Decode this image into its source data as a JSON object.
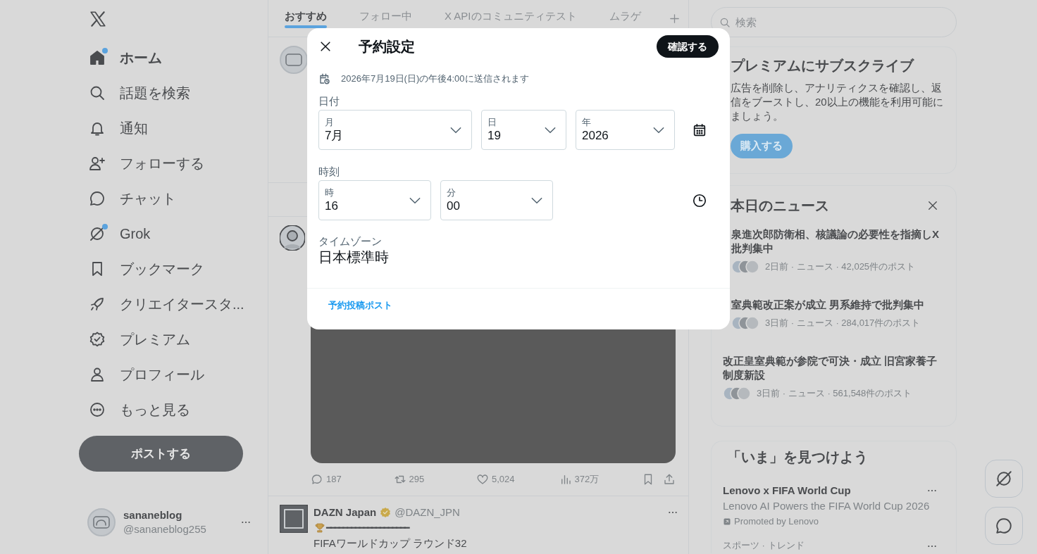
{
  "sidebar": {
    "items": [
      {
        "label": "ホーム",
        "selected": true,
        "notification_dot": true
      },
      {
        "label": "話題を検索",
        "selected": false,
        "notification_dot": false
      },
      {
        "label": "通知",
        "selected": false,
        "notification_dot": false
      },
      {
        "label": "フォローする",
        "selected": false,
        "notification_dot": false
      },
      {
        "label": "チャット",
        "selected": false,
        "notification_dot": false
      },
      {
        "label": "Grok",
        "selected": false,
        "notification_dot": true
      },
      {
        "label": "ブックマーク",
        "selected": false,
        "notification_dot": false
      },
      {
        "label": "クリエイタースタ...",
        "selected": false,
        "notification_dot": false
      },
      {
        "label": "プレミアム",
        "selected": false,
        "notification_dot": false
      },
      {
        "label": "プロフィール",
        "selected": false,
        "notification_dot": false
      },
      {
        "label": "もっと見る",
        "selected": false,
        "notification_dot": false
      }
    ],
    "post_button": "ポストする",
    "account": {
      "name": "sananeblog",
      "handle": "@sananeblog255"
    }
  },
  "timeline": {
    "tabs": [
      {
        "label": "おすすめ",
        "selected": true
      },
      {
        "label": "フォロー中",
        "selected": false
      },
      {
        "label": "X APIのコミュニティテスト",
        "selected": false
      },
      {
        "label": "ムラゲ",
        "selected": false
      }
    ],
    "post_stats": {
      "replies": "187",
      "reposts": "295",
      "likes": "5,024",
      "views": "372万"
    },
    "next_post": {
      "name": "DAZN Japan",
      "verified": true,
      "handle": "@DAZN_JPN",
      "lines": [
        "━━━━━━━━━━━━━━━━━━━━",
        "FIFAワールドカップ ラウンド32"
      ]
    }
  },
  "schedule_dialog": {
    "title": "予約設定",
    "confirm_button": "確認する",
    "summary": "2026年7月19日(日)の午後4:00に送信されます",
    "date_label": "日付",
    "date_fields": [
      {
        "label": "月",
        "value": "7月"
      },
      {
        "label": "日",
        "value": "19"
      },
      {
        "label": "年",
        "value": "2026"
      }
    ],
    "time_label": "時刻",
    "time_fields": [
      {
        "label": "時",
        "value": "16"
      },
      {
        "label": "分",
        "value": "00"
      }
    ],
    "timezone_label": "タイムゾーン",
    "timezone": "日本標準時",
    "footer_link": "予約投稿ポスト"
  },
  "right_column": {
    "search": {
      "placeholder": "検索"
    },
    "premium": {
      "title": "プレミアムにサブスクライブ",
      "lines": [
        "広告を削除し、アナリティクスを確認し、返",
        "信をブーストし、20以上の機能を利用可能に",
        "ましょう。"
      ],
      "button": "購入する"
    },
    "news": {
      "title": "本日のニュース",
      "items": [
        {
          "title_lines": [
            "泉進次郎防衛相、核議論の必要性を指摘しX",
            "批判集中"
          ],
          "meta": "2日前 · ニュース · 42,025件のポスト"
        },
        {
          "title_lines": [
            "室典範改正案が成立 男系維持で批判集中"
          ],
          "meta": "3日前 · ニュース · 284,017件のポスト"
        },
        {
          "title_lines": [
            "改正皇室典範が参院で可決・成立 旧宮家養子",
            "制度新設"
          ],
          "meta": "3日前 · ニュース · 561,548件のポスト"
        }
      ]
    },
    "discover": {
      "title": "「いま」を見つけよう",
      "items": [
        {
          "kind": "promoted",
          "title": "Lenovo x FIFA World Cup",
          "subtitle": "Lenovo AI Powers the FIFA World Cup 2026",
          "promoted": "Promoted by Lenovo"
        },
        {
          "kind": "trend",
          "category": "スポーツ · トレンド"
        }
      ]
    }
  }
}
